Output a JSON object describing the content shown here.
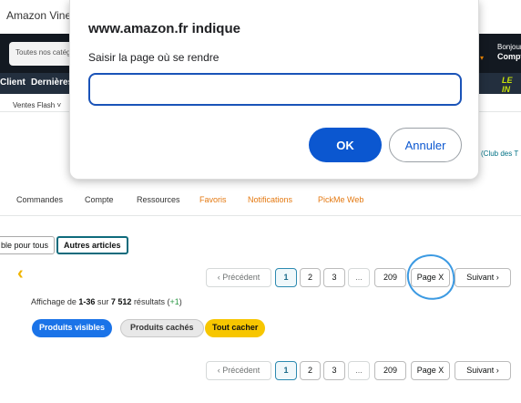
{
  "tab": {
    "title": "Amazon Vine"
  },
  "header": {
    "search_category": "Toutes nos catég",
    "greeting": "Bonjour",
    "account": "Compt"
  },
  "subnav": {
    "items": [
      "Client",
      "Dernières"
    ],
    "promo_text": "LE IN"
  },
  "flash": {
    "label": "Ventes Flash ˅"
  },
  "club_link": "(Club des T",
  "vine_nav": {
    "items": [
      "Commandes",
      "Compte",
      "Ressources",
      "Favoris",
      "Notifications",
      "PickMe Web"
    ]
  },
  "filters_top": {
    "available_label": "ble pour tous",
    "other_label": "Autres articles"
  },
  "pagination": {
    "prev": "‹ Précédent",
    "pages": [
      "1",
      "2",
      "3",
      "...",
      "209"
    ],
    "page_x": "Page X",
    "next": "Suivant ›"
  },
  "results": {
    "prefix": "Affichage de ",
    "range": "1-36",
    "middle": " sur ",
    "total": "7 512",
    "suffix": " résultats (",
    "delta": "+1",
    "close": ")"
  },
  "visibility_filters": {
    "visible": "Produits visibles",
    "hidden": "Produits cachés",
    "hide_all": "Tout cacher"
  },
  "dialog": {
    "title": "www.amazon.fr indique",
    "message": "Saisir la page où se rendre",
    "input_value": "",
    "ok_label": "OK",
    "cancel_label": "Annuler"
  },
  "colors": {
    "accent": "#0b57d0",
    "vine_orange": "#e47911",
    "hide_all": "#f7c600",
    "visible_blue": "#1a73e8"
  }
}
